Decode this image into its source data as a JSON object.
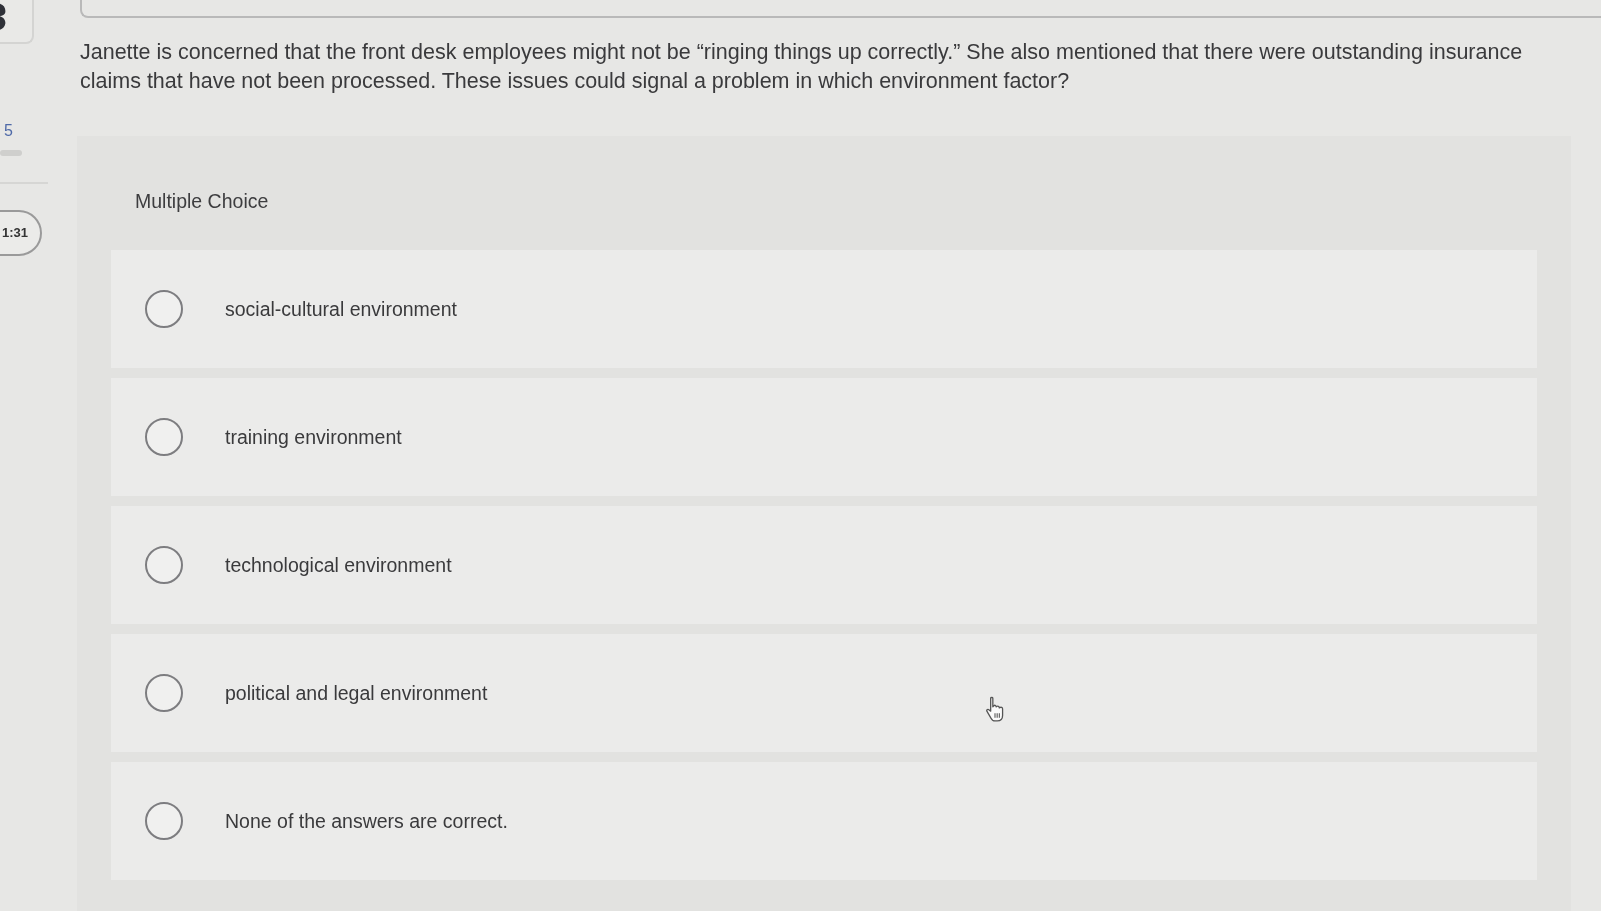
{
  "sidebar": {
    "page_count": "5",
    "timer": "1:31"
  },
  "question": {
    "text": "Janette is concerned that the front desk employees might not be “ringing things up correctly.” She also mentioned that there were outstanding insurance claims that have not been processed. These issues could signal a problem in which environment factor?"
  },
  "choices": {
    "label": "Multiple Choice",
    "options": [
      {
        "text": "social-cultural environment",
        "selected": false
      },
      {
        "text": "training environment",
        "selected": false
      },
      {
        "text": "technological environment",
        "selected": false
      },
      {
        "text": "political and legal environment",
        "selected": false
      },
      {
        "text": "None of the answers are correct.",
        "selected": false
      }
    ]
  }
}
